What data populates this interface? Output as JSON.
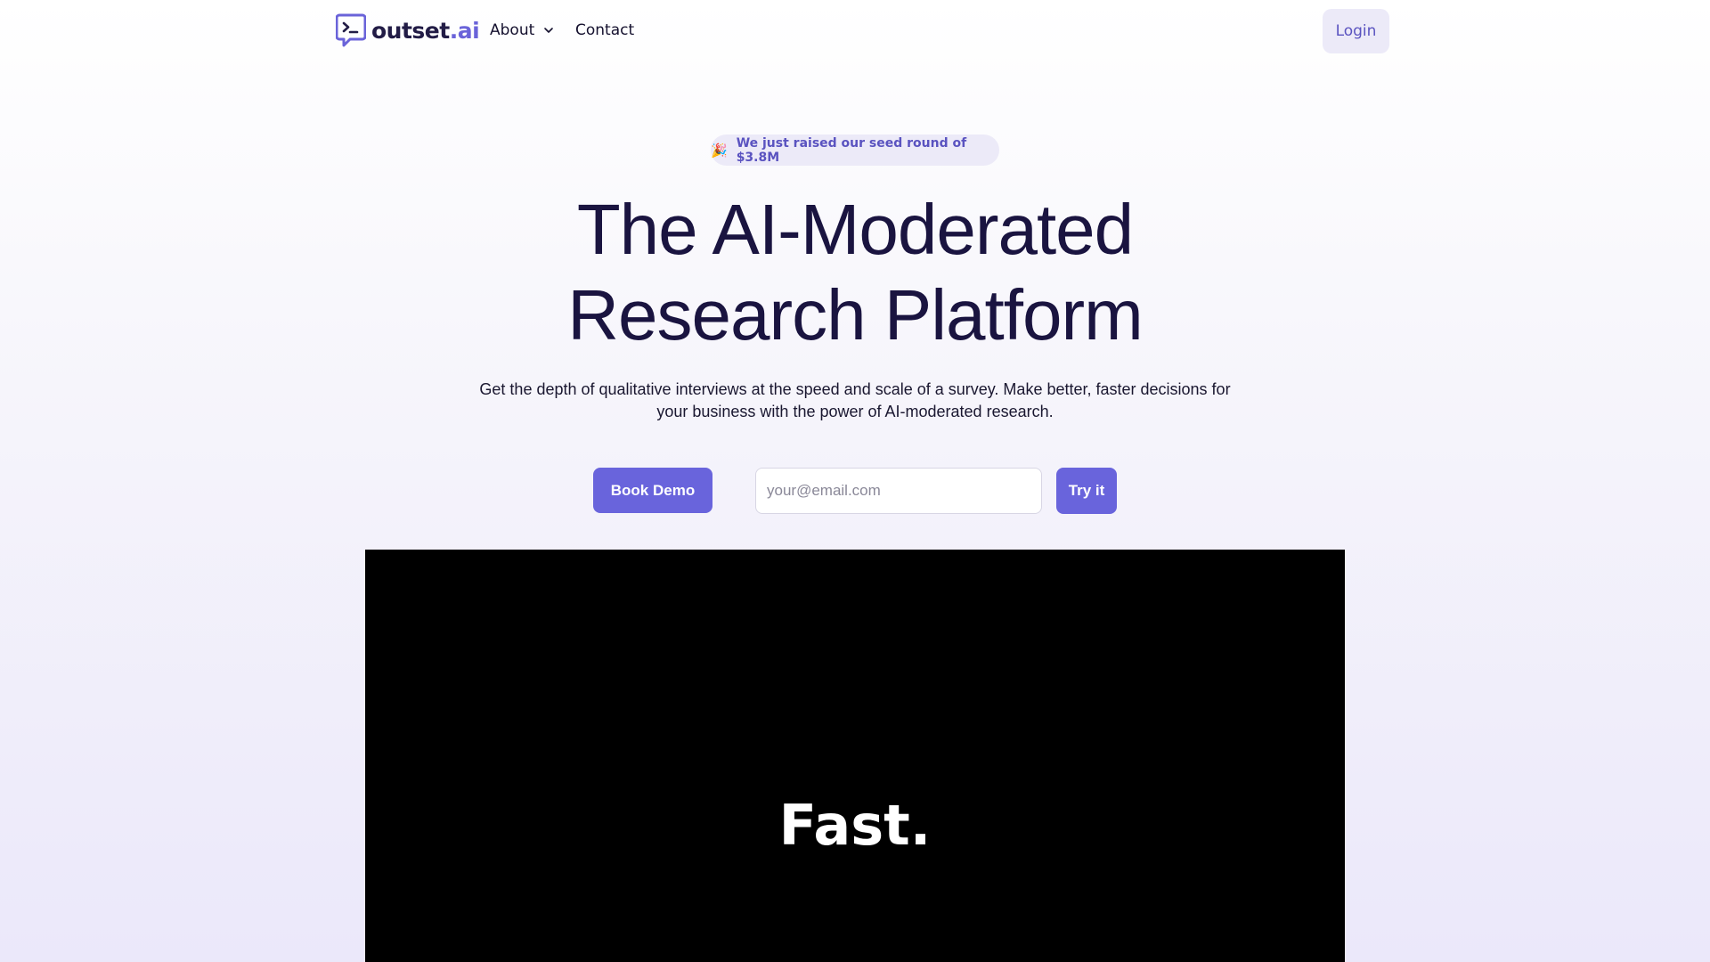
{
  "nav": {
    "logo_name": "outset",
    "logo_tld": ".ai",
    "about_label": "About",
    "contact_label": "Contact",
    "login_label": "Login"
  },
  "announcement": {
    "icon": "party-popper-icon",
    "emoji": "🎉",
    "text": "We just raised our seed round of $3.8M"
  },
  "hero": {
    "title_line1": "The AI-Moderated",
    "title_line2": "Research Platform",
    "subtitle": "Get the depth of qualitative interviews at the speed and scale of a survey. Make better, faster decisions for your business with the power of AI-moderated research.",
    "book_demo_label": "Book Demo",
    "email_placeholder": "your@email.com",
    "email_value": "",
    "try_label": "Try it"
  },
  "video": {
    "caption": "Fast."
  },
  "colors": {
    "brand": "#6964dc",
    "heading": "#1a1440",
    "pill_bg": "#eceaf8"
  }
}
